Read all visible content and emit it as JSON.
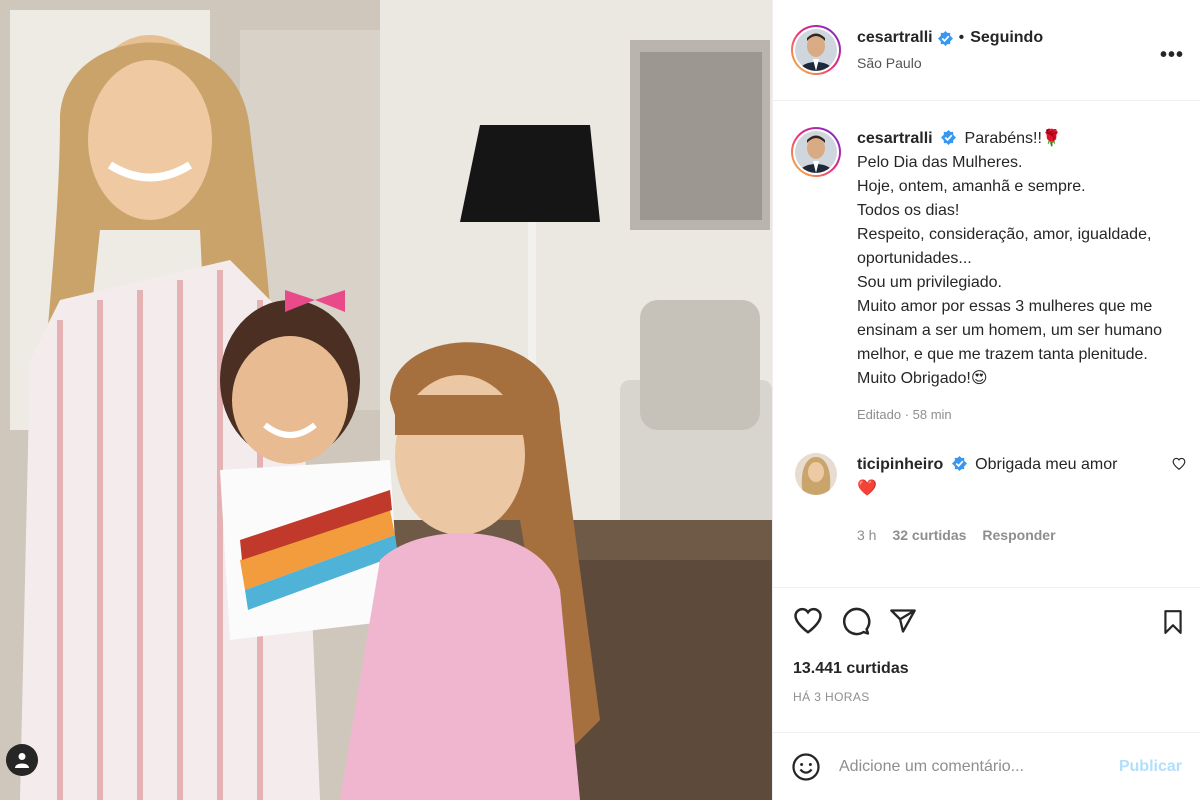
{
  "post": {
    "photo_alt": "",
    "header": {
      "username": "cesartralli",
      "verified_icon": "verified-badge-icon",
      "separator": "•",
      "follow_label": "Seguindo",
      "location": "São Paulo",
      "more_label": "•••"
    },
    "caption": {
      "username": "cesartralli",
      "lines": [
        "Parabéns!!🌹",
        "Pelo Dia das Mulheres.",
        "Hoje, ontem, amanhã e sempre.",
        "Todos os dias!",
        "Respeito, consideração, amor, igualdade, oportunidades...",
        "Sou um privilegiado.",
        "Muito amor por essas 3 mulheres que me ensinam a ser um homem, um ser humano melhor, e que me trazem tanta plenitude. Muito Obrigado!😍"
      ],
      "edited": "Editado · 58 min"
    },
    "comments": [
      {
        "username": "ticipinheiro",
        "text": "Obrigada meu amor",
        "emoji": "❤️",
        "time": "3 h",
        "likes": "32 curtidas",
        "reply_label": "Responder"
      }
    ],
    "actions": {
      "likes": "13.441 curtidas",
      "time_ago": "HÁ 3 HORAS"
    },
    "add_comment": {
      "placeholder": "Adicione um comentário...",
      "publish_label": "Publicar"
    },
    "colors": {
      "accent_blue": "#0095f6",
      "publish_disabled": "#b2dffc",
      "verified": "#3897f0",
      "like_red": "#ed4956"
    }
  }
}
